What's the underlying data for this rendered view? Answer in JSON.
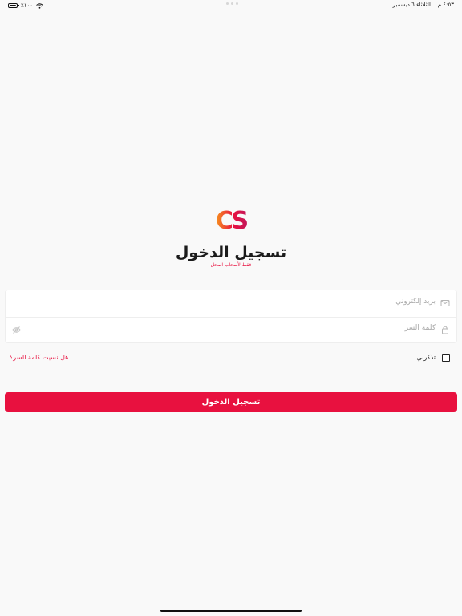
{
  "status_bar": {
    "battery_percent": "٪١٠٠",
    "time": "٤:٥٣ م",
    "date": "الثلاثاء ٦ ديسمبر"
  },
  "brand": {
    "logo_text": "CS",
    "accent_color": "#e8113f",
    "logo_gradient": [
      "#f7941d",
      "#e8113f",
      "#c2185b"
    ]
  },
  "header": {
    "title": "تسجيل الدخول",
    "subtitle": "فقط لأصحاب المحل"
  },
  "form": {
    "email_placeholder": "بريد إلكتروني",
    "password_placeholder": "كلمة السر",
    "remember_label": "تذكرني",
    "remember_checked": false,
    "forgot_link": "هل نسيت كلمة السر؟",
    "submit_label": "تسجيل الدخول"
  },
  "icons": {
    "email": "mail-icon",
    "password": "lock-icon",
    "show_password": "eye-off-icon"
  }
}
